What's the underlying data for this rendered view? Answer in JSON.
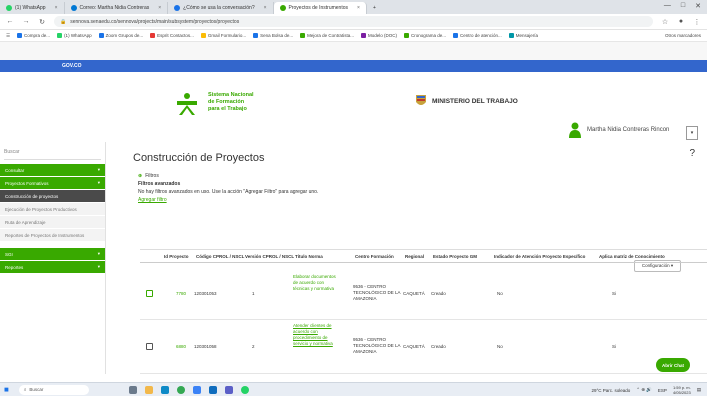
{
  "browser": {
    "tabs": [
      {
        "label": "(1) WhatsApp",
        "color": "#25d366"
      },
      {
        "label": "Correo: Martha Nidia Contreras",
        "color": "#0078d4"
      },
      {
        "label": "¿Cómo se usa la conversación?",
        "color": "#1a73e8"
      },
      {
        "label": "Proyectos de Instrumentos",
        "color": "#39a900",
        "active": true
      }
    ],
    "new_tab": "+",
    "window_controls": [
      "—",
      "□",
      "✕"
    ],
    "url": "sennova.senaedu.co/sennova/projects/main/subsystem/proyectos/proyectos",
    "bookmarks": [
      {
        "label": "Compra de...",
        "color": "#1a73e8"
      },
      {
        "label": "(1) WhatsApp",
        "color": "#25d366"
      },
      {
        "label": "Zoom Grupos de...",
        "color": "#1a73e8"
      },
      {
        "label": "Esprit Contactos...",
        "color": "#e53935"
      },
      {
        "label": "Gmail Formulario...",
        "color": "#fbbc05"
      },
      {
        "label": "Sena Bolsa de...",
        "color": "#1a73e8"
      },
      {
        "label": "Mejora de Contratista...",
        "color": "#39a900"
      },
      {
        "label": "Modelo (DOC)",
        "color": "#7b1fa2"
      },
      {
        "label": "Cronograma de...",
        "color": "#39a900"
      },
      {
        "label": "Centro de atención...",
        "color": "#1a73e8"
      },
      {
        "label": "Mensajería",
        "color": "#0097a7"
      }
    ],
    "bookmarks_right": "Otros marcadores"
  },
  "gov": {
    "label": "GOV.CO"
  },
  "header": {
    "sena_line1": "Sistema Nacional",
    "sena_line2": "de Formación",
    "sena_line3": "para el Trabajo",
    "sena_logo_text": "SENA",
    "ministerio": "MINISTERIO DEL TRABAJO",
    "user_name": "Martha Nidia Contreras Rincon"
  },
  "sidebar": {
    "search_placeholder": "Buscar",
    "items": [
      {
        "label": "Consultar",
        "style": "green",
        "arrow": "▾"
      },
      {
        "label": "Proyectos Formativos",
        "style": "green",
        "arrow": "▾"
      },
      {
        "label": "Construcción de proyectos",
        "style": "dark",
        "arrow": ""
      },
      {
        "label": "Ejecución de Proyectos Productivos",
        "style": "grey",
        "arrow": ""
      },
      {
        "label": "Ruta de Aprendizaje",
        "style": "grey",
        "arrow": ""
      },
      {
        "label": "Reportes de Proyectos de Instrumentos",
        "style": "grey",
        "arrow": ""
      },
      {
        "label": "SGI",
        "style": "green",
        "arrow": "▾"
      },
      {
        "label": "Reportes",
        "style": "green",
        "arrow": "▾"
      }
    ]
  },
  "main": {
    "title": "Construcción de Proyectos",
    "help": "?",
    "filters_label": "Filtros",
    "filters_advanced": "Filtros avanzados",
    "filters_hint": "No hay filtros avanzados en uso. Use la acción \"Agregar Filtro\" para agregar uno.",
    "filters_action": "Agregar filtro",
    "config_button": "Configuración ▾",
    "columns": [
      "Id Proyecto",
      "Código CPROL / NSCL",
      "Versión CPROL / NSCL",
      "Título Norma",
      "Centro Formación",
      "Regional",
      "Estado Proyecto GM",
      "Indicador de Atención Proyecto Específico",
      "Aplica matriz de Conocimiento"
    ],
    "rows": [
      {
        "id": "7780",
        "codigo": "120301053",
        "version": "1",
        "titulo": "Elaborar documentos de acuerdo con técnicas y normativa",
        "centro": "9536 - CENTRO TECNOLÓGICO DE LA AMAZONIA",
        "regional": "CAQUETÁ",
        "estado": "Creado",
        "indicador": "No",
        "matriz": "Si"
      },
      {
        "id": "6880",
        "codigo": "120301058",
        "version": "2",
        "titulo": "Atender clientes de acuerdo con procedimiento de servicio y normativa",
        "centro": "9536 - CENTRO TECNOLÓGICO DE LA AMAZONIA",
        "regional": "CAQUETÁ",
        "estado": "Creado",
        "indicador": "No",
        "matriz": "Si"
      }
    ],
    "chat_button": "Abrir Chat"
  },
  "taskbar": {
    "search_placeholder": "Buscar",
    "weather": "29°C Parc. soleado",
    "time": "1:59 p. m.",
    "date": "4/05/2023",
    "lang": "ESP"
  }
}
